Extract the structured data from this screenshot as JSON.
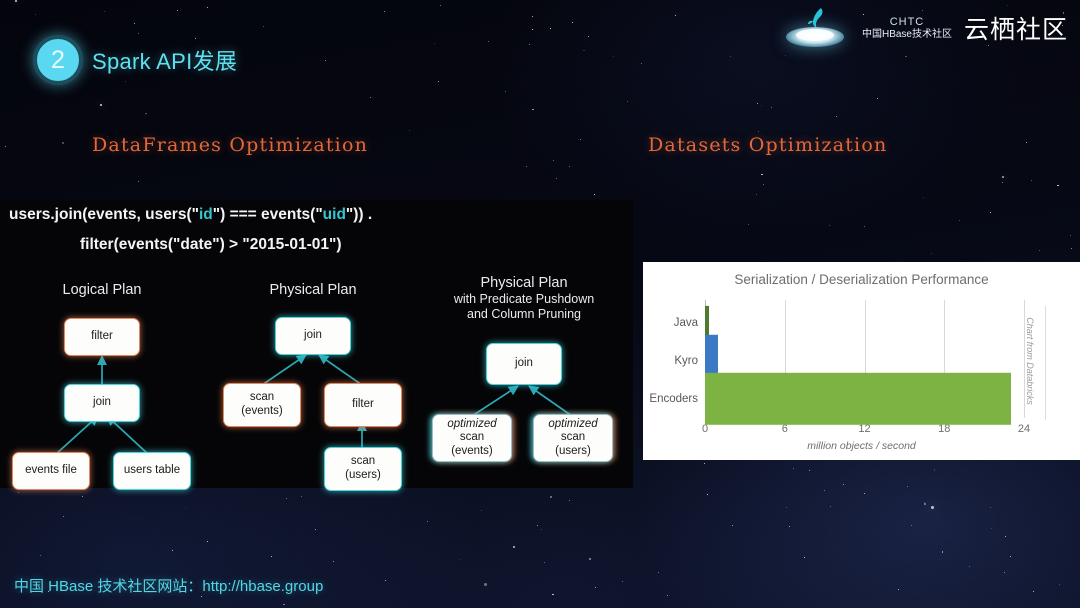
{
  "header": {
    "badge_number": "2",
    "title": "Spark API发展"
  },
  "brand": {
    "logo_icon": "dolphin-on-disc-icon",
    "abbr": "CHTC",
    "cn_name": "中国HBase技术社区",
    "partner": "云栖社区"
  },
  "sections": {
    "left_caption": "DataFrames Optimization",
    "right_caption": "Datasets Optimization"
  },
  "code": {
    "line1_a": "users.join(events, users(\"",
    "line1_id": "id",
    "line1_b": "\") === events(\"",
    "line1_uid": "uid",
    "line1_c": "\")) .",
    "line2": "filter(events(\"date\") > \"2015-01-01\")"
  },
  "plans": [
    {
      "title": "Logical Plan",
      "subtitle": "",
      "nodes": [
        {
          "label": "filter",
          "style": "orange"
        },
        {
          "label": "join",
          "style": "teal"
        },
        {
          "label": "events file",
          "style": "orange"
        },
        {
          "label": "users table",
          "style": "teal"
        }
      ]
    },
    {
      "title": "Physical Plan",
      "subtitle": "",
      "nodes": [
        {
          "label": "join",
          "style": "teal"
        },
        {
          "label": "scan\n(events)",
          "style": "orange"
        },
        {
          "label": "filter",
          "style": "orange"
        },
        {
          "label": "scan\n(users)",
          "style": "teal"
        }
      ]
    },
    {
      "title": "Physical Plan",
      "subtitle": "with Predicate Pushdown\nand Column Pruning",
      "nodes": [
        {
          "label": "join",
          "style": "teal"
        },
        {
          "label": "optimized scan (events)",
          "style": "both"
        },
        {
          "label": "optimized scan (users)",
          "style": "both"
        }
      ]
    }
  ],
  "node_text": {
    "logical_filter": "filter",
    "logical_join": "join",
    "logical_events_file": "events file",
    "logical_users_table": "users table",
    "physical_join": "join",
    "physical_scan_events_l1": "scan",
    "physical_scan_events_l2": "(events)",
    "physical_filter": "filter",
    "physical_scan_users_l1": "scan",
    "physical_scan_users_l2": "(users)",
    "opt_join": "join",
    "opt_scan_events_l1": "optimized",
    "opt_scan_events_l2": "scan",
    "opt_scan_events_l3": "(events)",
    "opt_scan_users_l1": "optimized",
    "opt_scan_users_l2": "scan",
    "opt_scan_users_l3": "(users)"
  },
  "plan_titles": {
    "logical": "Logical Plan",
    "physical": "Physical Plan",
    "optimized_t1": "Physical Plan",
    "optimized_t2": "with Predicate Pushdown",
    "optimized_t3": "and Column Pruning"
  },
  "chart_data": {
    "type": "bar",
    "orientation": "horizontal",
    "title": "Serialization / Deserialization Performance",
    "xlabel": "million objects / second",
    "ylabel": "",
    "categories": [
      "Java",
      "Kyro",
      "Encoders"
    ],
    "values": [
      0.3,
      1.0,
      23.0
    ],
    "colors": [
      "#4e7a2c",
      "#3a7ac4",
      "#7cb342"
    ],
    "xlim": [
      0,
      24
    ],
    "xticks": [
      0,
      6,
      12,
      18,
      24
    ],
    "xtick_labels": [
      "0",
      "6",
      "12",
      "18",
      "24"
    ],
    "grid": true,
    "legend": "none",
    "annotation": "Chart from Databricks"
  },
  "footer": {
    "text": "中国 HBase 技术社区网站：http://hbase.group"
  },
  "colors": {
    "accent_cyan": "#5ee0f0",
    "caption_orange": "#e2683a",
    "panel_bg": "#050507"
  }
}
